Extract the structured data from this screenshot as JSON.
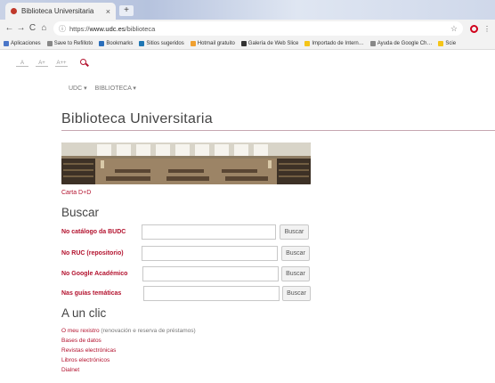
{
  "browser": {
    "tab_title": "Biblioteca Universitaria",
    "tab_close": "×",
    "new_tab": "+",
    "url_prefix": "https://",
    "url_domain": "www.udc.es",
    "url_path": "/biblioteca",
    "nav": {
      "back": "←",
      "forward": "→",
      "reload": "C",
      "home": "⌂",
      "info": "ⓘ"
    },
    "star": "☆",
    "menu": "⋮",
    "bookmarks": [
      {
        "label": "Aplicaciones",
        "color": "#4a76c8"
      },
      {
        "label": "Save to Refilloto",
        "color": "#888888"
      },
      {
        "label": "Bookmarks",
        "color": "#2a6ebb"
      },
      {
        "label": "Sitios sugeridos",
        "color": "#1f77b4"
      },
      {
        "label": "Hotmail gratuito",
        "color": "#f0a030"
      },
      {
        "label": "Galería de Web Slice",
        "color": "#333333"
      },
      {
        "label": "Importado de Intern…",
        "color": "#f5c518"
      },
      {
        "label": "Ayuda de Google Ch…",
        "color": "#888888"
      },
      {
        "label": "Scie",
        "color": "#f5c518"
      }
    ]
  },
  "page": {
    "font_sizes": [
      "A",
      "A+",
      "A++"
    ],
    "menu": [
      "UDC ▾",
      "BIBLIOTECA ▾"
    ],
    "title": "Biblioteca Universitaria",
    "carta_link": "Carta D+D",
    "buscar_heading": "Buscar",
    "search_rows": [
      {
        "label": "No catálogo da BUDC",
        "button": "Buscar"
      },
      {
        "label": "No RUC (repositorio)",
        "button": "Buscar"
      },
      {
        "label": "No Google Académico",
        "button": "Buscar"
      },
      {
        "label": "Nas guías temáticas",
        "button": "Buscar"
      }
    ],
    "clic_heading": "A un clic",
    "clic_links": [
      {
        "link": "O meu rexistro",
        "rest": " (renovación e reserva de préstamos)"
      },
      {
        "link": "Bases de datos",
        "rest": ""
      },
      {
        "link": "Revistas electrónicas",
        "rest": ""
      },
      {
        "link": "Libros electrónicos",
        "rest": ""
      },
      {
        "link": "Dialnet",
        "rest": ""
      }
    ]
  },
  "colors": {
    "accent": "#b3122e",
    "rule": "#c6a7b1"
  }
}
